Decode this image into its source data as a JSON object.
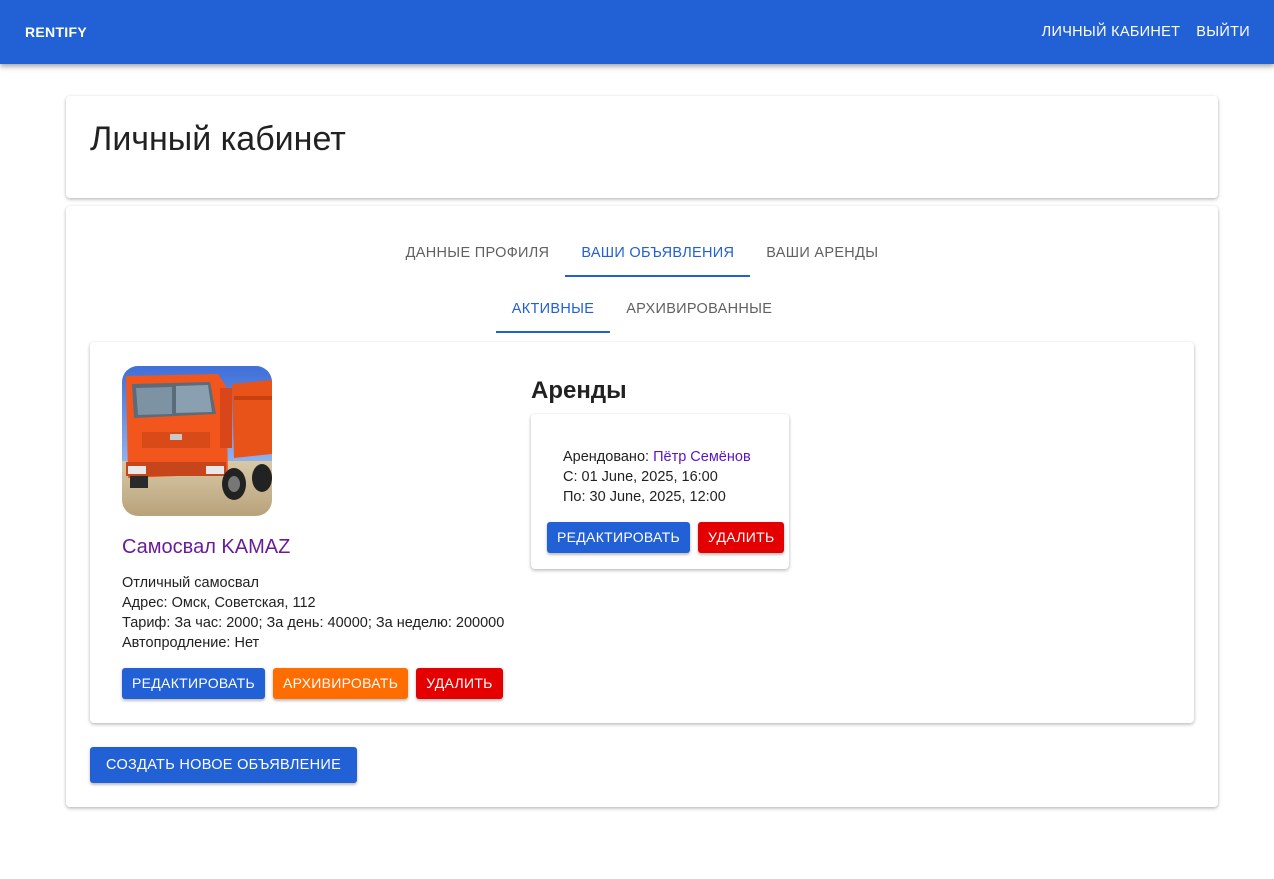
{
  "appbar": {
    "brand": "RENTIFY",
    "nav": {
      "cabinet": "ЛИЧНЫЙ КАБИНЕТ",
      "logout": "ВЫЙТИ"
    },
    "color": "#2260d6"
  },
  "page": {
    "title": "Личный кабинет"
  },
  "tabs": [
    {
      "label": "ДАННЫЕ ПРОФИЛЯ",
      "active": false
    },
    {
      "label": "ВАШИ ОБЪЯВЛЕНИЯ",
      "active": true
    },
    {
      "label": "ВАШИ АРЕНДЫ",
      "active": false
    }
  ],
  "subtabs": [
    {
      "label": "АКТИВНЫЕ",
      "active": true
    },
    {
      "label": "АРХИВИРОВАННЫЕ",
      "active": false
    }
  ],
  "listing": {
    "image_icon": "orange-dump-truck-photo",
    "title": "Самосвал KAMAZ",
    "description": "Отличный самосвал",
    "address": "Адрес: Омск, Советская, 112",
    "tariff": "Тариф: За час: 2000; За день: 40000; За неделю: 200000",
    "autorenew": "Автопродление: Нет",
    "buttons": {
      "edit": "РЕДАКТИРОВАТЬ",
      "archive": "АРХИВИРОВАТЬ",
      "delete": "УДАЛИТЬ"
    }
  },
  "rentals": {
    "heading": "Аренды",
    "items": [
      {
        "rented_by_label": "Арендовано:",
        "renter": "Пётр Семёнов",
        "from": "С: 01 June, 2025, 16:00",
        "to": "По: 30 June, 2025, 12:00",
        "buttons": {
          "edit": "РЕДАКТИРОВАТЬ",
          "delete": "УДАЛИТЬ"
        }
      }
    ]
  },
  "create_button": "СОЗДАТЬ НОВОЕ ОБЪЯВЛЕНИЕ",
  "colors": {
    "primary": "#2260d6",
    "archive": "#ff6d00",
    "danger": "#e40000",
    "title_purple": "#6a1b9a"
  }
}
